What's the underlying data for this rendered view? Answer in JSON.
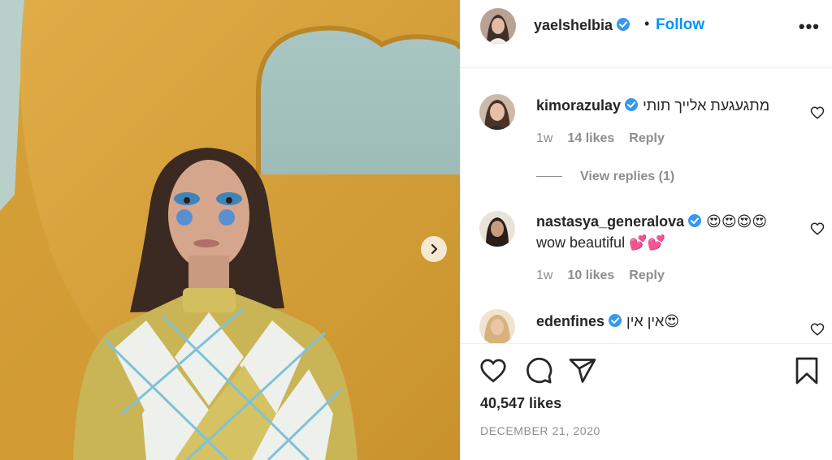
{
  "post": {
    "image_alt": "Woman with blue eye makeup wearing an argyle sweater in front of a yellow wall",
    "next_icon": "chevron-right-icon"
  },
  "header": {
    "username": "yaelshelbia",
    "verified_icon": "verified-badge-icon",
    "separator": "•",
    "follow_label": "Follow",
    "more_icon": "more-options-icon",
    "more_label": "•••"
  },
  "comments": [
    {
      "username": "kimorazulay",
      "verified": true,
      "text": "מתגעגעת אלייך תותי",
      "time": "1w",
      "likes": "14 likes",
      "reply": "Reply",
      "view_replies": "View replies (1)"
    },
    {
      "username": "nastasya_generalova",
      "verified": true,
      "text": "😍😍😍😍",
      "text2": "wow beautiful 💕💕",
      "time": "1w",
      "likes": "10 likes",
      "reply": "Reply"
    },
    {
      "username": "edenfines",
      "verified": true,
      "text": "אין אין😍"
    }
  ],
  "actions": {
    "like_icon": "heart-icon",
    "comment_icon": "comment-icon",
    "share_icon": "share-icon",
    "save_icon": "bookmark-icon",
    "likes_total": "40,547 likes",
    "date": "DECEMBER 21, 2020"
  },
  "colors": {
    "link": "#0095f6",
    "verified": "#3897f0",
    "secondary_text": "#8e8e8e",
    "wall": "#d9a33a"
  }
}
